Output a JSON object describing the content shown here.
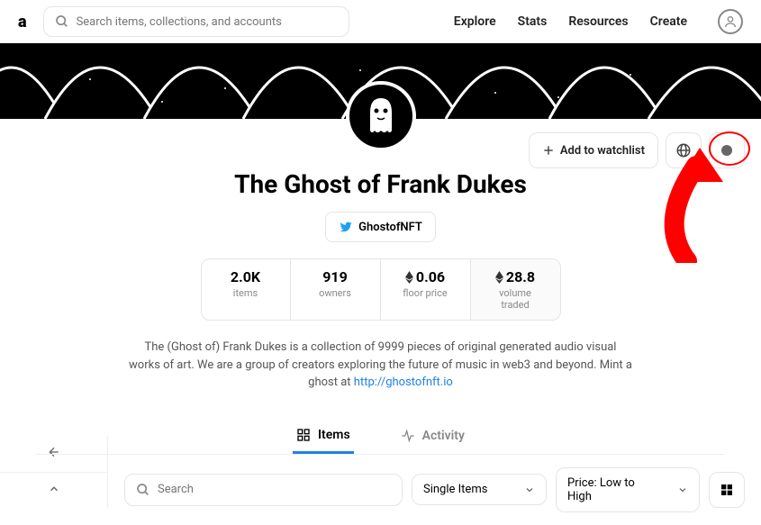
{
  "header": {
    "search_placeholder": "Search items, collections, and accounts",
    "nav": {
      "explore": "Explore",
      "stats": "Stats",
      "resources": "Resources",
      "create": "Create"
    }
  },
  "collection": {
    "title": "The Ghost of Frank Dukes",
    "twitter_handle": "GhostofNFT",
    "description_pre": "The (Ghost of) Frank Dukes is a collection of 9999 pieces of original generated audio visual works of art. We are a group of creators exploring the future of music in web3 and beyond. Mint a ghost at ",
    "description_link_text": "http://ghostofnft.io",
    "watchlist_label": "Add to watchlist"
  },
  "stats": {
    "items": {
      "value": "2.0K",
      "label": "items"
    },
    "owners": {
      "value": "919",
      "label": "owners"
    },
    "floor": {
      "value": "0.06",
      "label": "floor price"
    },
    "volume": {
      "value": "28.8",
      "label": "volume traded"
    }
  },
  "tabs": {
    "items": "Items",
    "activity": "Activity"
  },
  "filters": {
    "search_placeholder": "Search",
    "dropdown1": "Single Items",
    "dropdown2": "Price: Low to High"
  }
}
